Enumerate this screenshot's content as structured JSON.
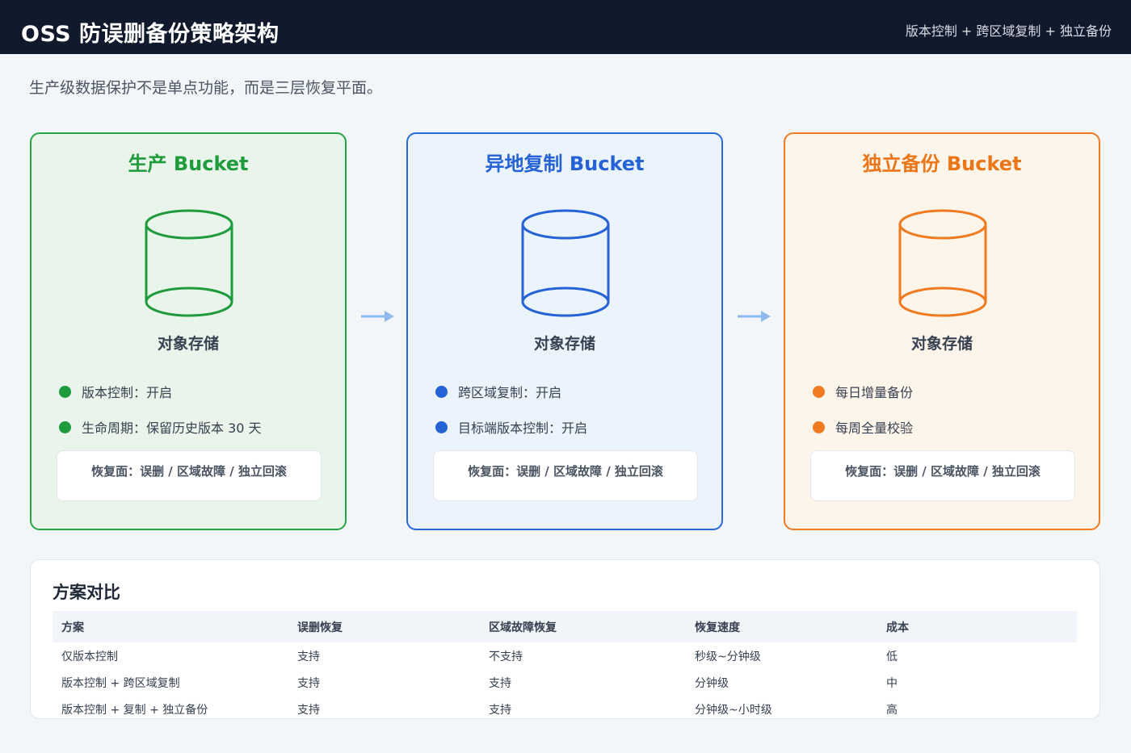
{
  "header": {
    "title": "OSS 防误删备份策略架构",
    "tagline": "版本控制 + 跨区域复制 + 独立备份"
  },
  "subtitle": "生产级数据保护不是单点功能，而是三层恢复平面。",
  "colors": {
    "production": "#1e9b3c",
    "replication": "#2462d6",
    "backup": "#ec7516",
    "arrow": "#8fbaf0",
    "header_bg": "#111a2c"
  },
  "buckets": [
    {
      "title": "生产 Bucket",
      "icon": "cylinder-icon",
      "label": "对象存储",
      "features": [
        "版本控制：开启",
        "生命周期：保留历史版本 30 天"
      ],
      "recover": "恢复面：误删 / 区域故障 / 独立回滚"
    },
    {
      "title": "异地复制 Bucket",
      "icon": "cylinder-icon",
      "label": "对象存储",
      "features": [
        "跨区域复制：开启",
        "目标端版本控制：开启"
      ],
      "recover": "恢复面：误删 / 区域故障 / 独立回滚"
    },
    {
      "title": "独立备份 Bucket",
      "icon": "cylinder-icon",
      "label": "对象存储",
      "features": [
        "每日增量备份",
        "每周全量校验"
      ],
      "recover": "恢复面：误删 / 区域故障 / 独立回滚"
    }
  ],
  "comparison": {
    "title": "方案对比",
    "columns": [
      "方案",
      "误删恢复",
      "区域故障恢复",
      "恢复速度",
      "成本"
    ],
    "rows": [
      [
        "仅版本控制",
        "支持",
        "不支持",
        "秒级~分钟级",
        "低"
      ],
      [
        "版本控制 + 跨区域复制",
        "支持",
        "支持",
        "分钟级",
        "中"
      ],
      [
        "版本控制 + 复制 + 独立备份",
        "支持",
        "支持",
        "分钟级~小时级",
        "高"
      ]
    ]
  }
}
